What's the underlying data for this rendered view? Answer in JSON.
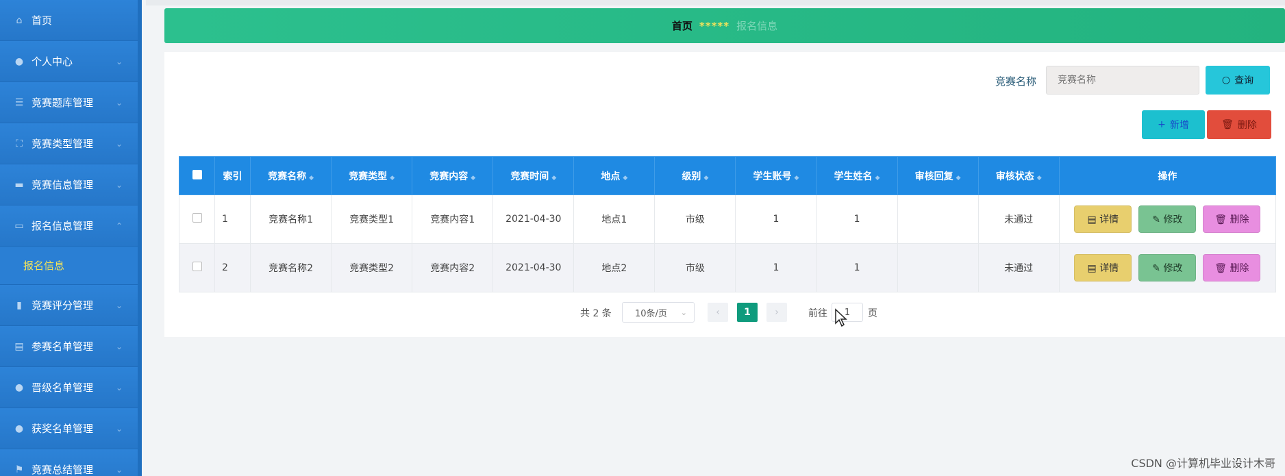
{
  "sidebar": {
    "items": [
      {
        "label": "首页",
        "icon": "home-icon",
        "expandable": false
      },
      {
        "label": "个人中心",
        "icon": "user-icon",
        "expandable": true
      },
      {
        "label": "竞赛题库管理",
        "icon": "sliders-icon",
        "expandable": true
      },
      {
        "label": "竞赛类型管理",
        "icon": "frame-icon",
        "expandable": true
      },
      {
        "label": "竞赛信息管理",
        "icon": "briefcase-icon",
        "expandable": true
      },
      {
        "label": "报名信息管理",
        "icon": "message-icon",
        "expandable": true,
        "expanded": true
      },
      {
        "label": "竞赛评分管理",
        "icon": "chart-icon",
        "expandable": true
      },
      {
        "label": "参赛名单管理",
        "icon": "clipboard-icon",
        "expandable": true
      },
      {
        "label": "晋级名单管理",
        "icon": "user-icon",
        "expandable": true
      },
      {
        "label": "获奖名单管理",
        "icon": "user-icon",
        "expandable": true
      },
      {
        "label": "竞赛总结管理",
        "icon": "flag-icon",
        "expandable": true
      }
    ],
    "sub_item": "报名信息"
  },
  "breadcrumb": {
    "home": "首页",
    "separator": "*****",
    "current": "报名信息"
  },
  "search": {
    "label": "竞赛名称",
    "placeholder": "竞赛名称",
    "button": "查询"
  },
  "actions": {
    "add": "新增",
    "delete": "删除"
  },
  "table": {
    "headers": [
      "索引",
      "竞赛名称",
      "竞赛类型",
      "竞赛内容",
      "竞赛时间",
      "地点",
      "级别",
      "学生账号",
      "学生姓名",
      "审核回复",
      "审核状态",
      "操作"
    ],
    "rows": [
      [
        "1",
        "竞赛名称1",
        "竞赛类型1",
        "竞赛内容1",
        "2021-04-30",
        "地点1",
        "市级",
        "1",
        "1",
        "",
        "未通过"
      ],
      [
        "2",
        "竞赛名称2",
        "竞赛类型2",
        "竞赛内容2",
        "2021-04-30",
        "地点2",
        "市级",
        "1",
        "1",
        "",
        "未通过"
      ]
    ],
    "row_actions": {
      "detail": "详情",
      "edit": "修改",
      "remove": "删除"
    }
  },
  "pagination": {
    "total": "共 2 条",
    "page_size": "10条/页",
    "current_page": "1",
    "goto_label": "前往",
    "goto_value": "1",
    "unit": "页"
  },
  "watermark": "CSDN @计算机毕业设计木哥",
  "colors": {
    "sidebar": "#2a7fd4",
    "header_bar": "#2cc08e",
    "table_header": "#1f8ae3",
    "query_button": "#26c6da",
    "delete_button": "#e24d3c",
    "detail_button": "#e8cf6e",
    "edit_button": "#79c392",
    "remove_button": "#e88ee0",
    "active_page": "#0f9b7d",
    "sub_item_text": "#f2e35b"
  }
}
